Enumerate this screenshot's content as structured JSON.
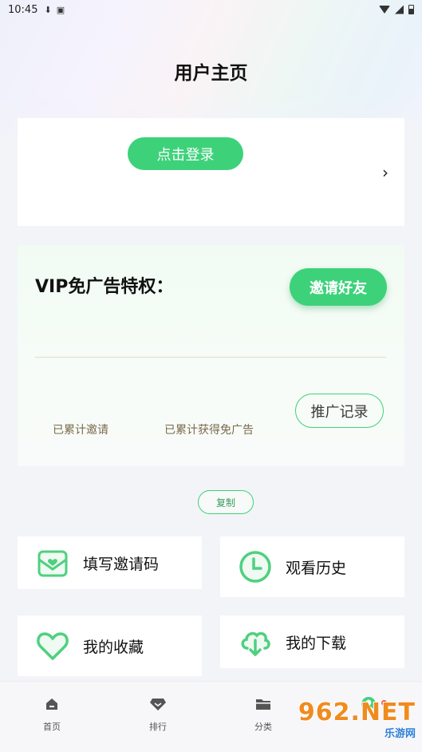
{
  "status_bar": {
    "time": "10:45"
  },
  "header": {
    "title": "用户主页"
  },
  "login": {
    "button_label": "点击登录",
    "chevron": "›"
  },
  "vip": {
    "title": "VIP免广告特权：",
    "invite_button": "邀请好友",
    "promo_button": "推广记录",
    "stat_invited": "已累计邀请",
    "stat_free": "已累计获得免广告"
  },
  "copy": {
    "button_label": "复制"
  },
  "grid": [
    {
      "label": "填写邀请码",
      "icon": "envelope-heart-icon"
    },
    {
      "label": "观看历史",
      "icon": "clock-icon"
    },
    {
      "label": "我的收藏",
      "icon": "heart-icon"
    },
    {
      "label": "我的下载",
      "icon": "cloud-download-icon"
    }
  ],
  "tabbar": [
    {
      "label": "首页",
      "icon": "home-icon"
    },
    {
      "label": "排行",
      "icon": "diamond-icon"
    },
    {
      "label": "分类",
      "icon": "folder-icon"
    },
    {
      "label": "",
      "icon": "profile-icon"
    }
  ],
  "watermark": {
    "main": "962.NET",
    "sub": "乐游网"
  },
  "colors": {
    "accent": "#3dd27a",
    "badge": "#f24b3d"
  }
}
